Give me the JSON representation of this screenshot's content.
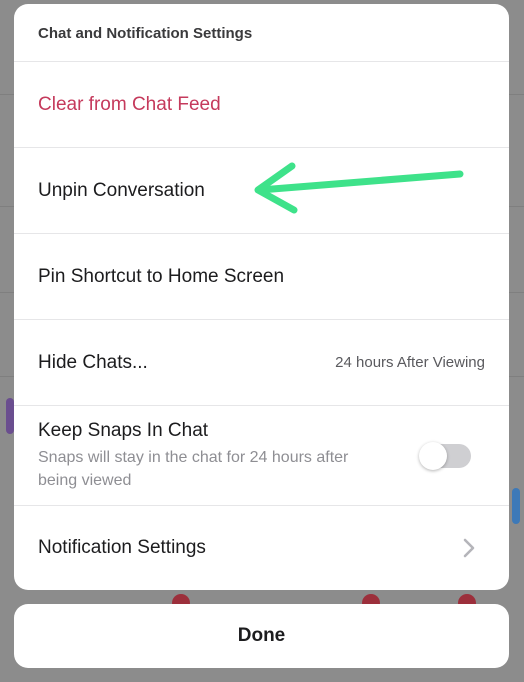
{
  "sheet": {
    "header": "Chat and Notification Settings",
    "items": [
      {
        "label": "Clear from Chat Feed"
      },
      {
        "label": "Unpin Conversation"
      },
      {
        "label": "Pin Shortcut to Home Screen"
      },
      {
        "label": "Hide Chats...",
        "value": "24 hours After Viewing"
      },
      {
        "label": "Keep Snaps In Chat",
        "subtitle": "Snaps will stay in the chat for 24 hours after being viewed",
        "toggle_on": false
      },
      {
        "label": "Notification Settings"
      }
    ]
  },
  "done_label": "Done",
  "colors": {
    "danger_text": "#c53a5c",
    "annotation_arrow": "#3ee28a",
    "toggle_off": "#cfcfd2"
  },
  "icons": {
    "chevron": "chevron-right-icon",
    "annotation": "annotation-arrow-icon"
  }
}
